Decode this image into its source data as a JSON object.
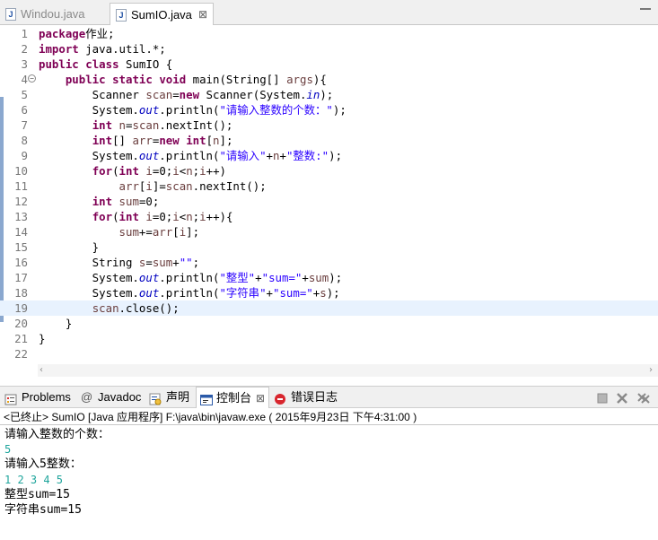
{
  "editor_tabs": [
    {
      "label": "Windou.java",
      "close": ""
    },
    {
      "label": "SumIO.java",
      "close": "⊠"
    }
  ],
  "code_lines": [
    {
      "n": "1",
      "parts": [
        [
          "kw",
          "package"
        ],
        [
          "",
          "作业;"
        ]
      ]
    },
    {
      "n": "2",
      "parts": [
        [
          "kw",
          "import"
        ],
        [
          "",
          " java.util.*;"
        ]
      ]
    },
    {
      "n": "3",
      "parts": [
        [
          "kw",
          "public"
        ],
        [
          "",
          " "
        ],
        [
          "kw",
          "class"
        ],
        [
          "",
          " SumIO {"
        ]
      ]
    },
    {
      "n": "4",
      "fold": "−",
      "parts": [
        [
          "",
          "    "
        ],
        [
          "kw",
          "public"
        ],
        [
          "",
          " "
        ],
        [
          "kw",
          "static"
        ],
        [
          "",
          " "
        ],
        [
          "kw",
          "void"
        ],
        [
          "",
          " main(String[] "
        ],
        [
          "var",
          "args"
        ],
        [
          "",
          "){"
        ]
      ]
    },
    {
      "n": "5",
      "parts": [
        [
          "",
          "        Scanner "
        ],
        [
          "var",
          "scan"
        ],
        [
          "",
          "="
        ],
        [
          "kw",
          "new"
        ],
        [
          "",
          " Scanner(System."
        ],
        [
          "fld",
          "in"
        ],
        [
          "",
          ");"
        ]
      ]
    },
    {
      "n": "6",
      "parts": [
        [
          "",
          "        System."
        ],
        [
          "fld",
          "out"
        ],
        [
          "",
          ".println("
        ],
        [
          "str",
          "\"请输入整数的个数：\""
        ],
        [
          "",
          ");"
        ]
      ]
    },
    {
      "n": "7",
      "parts": [
        [
          "",
          "        "
        ],
        [
          "kw",
          "int"
        ],
        [
          "",
          " "
        ],
        [
          "var",
          "n"
        ],
        [
          "",
          "="
        ],
        [
          "var",
          "scan"
        ],
        [
          "",
          ".nextInt();"
        ]
      ]
    },
    {
      "n": "8",
      "parts": [
        [
          "",
          "        "
        ],
        [
          "kw",
          "int"
        ],
        [
          "",
          "[] "
        ],
        [
          "var",
          "arr"
        ],
        [
          "",
          "="
        ],
        [
          "kw",
          "new"
        ],
        [
          "",
          " "
        ],
        [
          "kw",
          "int"
        ],
        [
          "",
          "["
        ],
        [
          "var",
          "n"
        ],
        [
          "",
          "];"
        ]
      ]
    },
    {
      "n": "9",
      "parts": [
        [
          "",
          "        System."
        ],
        [
          "fld",
          "out"
        ],
        [
          "",
          ".println("
        ],
        [
          "str",
          "\"请输入\""
        ],
        [
          "",
          "+"
        ],
        [
          "var",
          "n"
        ],
        [
          "",
          "+"
        ],
        [
          "str",
          "\"整数:\""
        ],
        [
          "",
          ");"
        ]
      ]
    },
    {
      "n": "10",
      "parts": [
        [
          "",
          "        "
        ],
        [
          "kw",
          "for"
        ],
        [
          "",
          "("
        ],
        [
          "kw",
          "int"
        ],
        [
          "",
          " "
        ],
        [
          "var",
          "i"
        ],
        [
          "",
          "=0;"
        ],
        [
          "var",
          "i"
        ],
        [
          "",
          "<"
        ],
        [
          "var",
          "n"
        ],
        [
          "",
          ";"
        ],
        [
          "var",
          "i"
        ],
        [
          "",
          "++)"
        ]
      ]
    },
    {
      "n": "11",
      "parts": [
        [
          "",
          "            "
        ],
        [
          "var",
          "arr"
        ],
        [
          "",
          "["
        ],
        [
          "var",
          "i"
        ],
        [
          "",
          "]="
        ],
        [
          "var",
          "scan"
        ],
        [
          "",
          ".nextInt();"
        ]
      ]
    },
    {
      "n": "12",
      "parts": [
        [
          "",
          "        "
        ],
        [
          "kw",
          "int"
        ],
        [
          "",
          " "
        ],
        [
          "var",
          "sum"
        ],
        [
          "",
          "=0;"
        ]
      ]
    },
    {
      "n": "13",
      "parts": [
        [
          "",
          "        "
        ],
        [
          "kw",
          "for"
        ],
        [
          "",
          "("
        ],
        [
          "kw",
          "int"
        ],
        [
          "",
          " "
        ],
        [
          "var",
          "i"
        ],
        [
          "",
          "=0;"
        ],
        [
          "var",
          "i"
        ],
        [
          "",
          "<"
        ],
        [
          "var",
          "n"
        ],
        [
          "",
          ";"
        ],
        [
          "var",
          "i"
        ],
        [
          "",
          "++){"
        ]
      ]
    },
    {
      "n": "14",
      "parts": [
        [
          "",
          "            "
        ],
        [
          "var",
          "sum"
        ],
        [
          "",
          "+="
        ],
        [
          "var",
          "arr"
        ],
        [
          "",
          "["
        ],
        [
          "var",
          "i"
        ],
        [
          "",
          "];"
        ]
      ]
    },
    {
      "n": "15",
      "parts": [
        [
          "",
          "        }"
        ]
      ]
    },
    {
      "n": "16",
      "parts": [
        [
          "",
          "        String "
        ],
        [
          "var",
          "s"
        ],
        [
          "",
          "="
        ],
        [
          "var",
          "sum"
        ],
        [
          "",
          "+"
        ],
        [
          "str",
          "\"\""
        ],
        [
          "",
          ";"
        ]
      ]
    },
    {
      "n": "17",
      "parts": [
        [
          "",
          "        System."
        ],
        [
          "fld",
          "out"
        ],
        [
          "",
          ".println("
        ],
        [
          "str",
          "\"整型\""
        ],
        [
          "",
          "+"
        ],
        [
          "str",
          "\"sum=\""
        ],
        [
          "",
          "+"
        ],
        [
          "var",
          "sum"
        ],
        [
          "",
          ");"
        ]
      ]
    },
    {
      "n": "18",
      "parts": [
        [
          "",
          "        System."
        ],
        [
          "fld",
          "out"
        ],
        [
          "",
          ".println("
        ],
        [
          "str",
          "\"字符串\""
        ],
        [
          "",
          "+"
        ],
        [
          "str",
          "\"sum=\""
        ],
        [
          "",
          "+"
        ],
        [
          "var",
          "s"
        ],
        [
          "",
          ");"
        ]
      ]
    },
    {
      "n": "19",
      "current": true,
      "parts": [
        [
          "",
          "        "
        ],
        [
          "var",
          "scan"
        ],
        [
          "",
          ".close();"
        ]
      ]
    },
    {
      "n": "20",
      "parts": [
        [
          "",
          "    }"
        ]
      ]
    },
    {
      "n": "21",
      "parts": [
        [
          "",
          "}"
        ]
      ]
    },
    {
      "n": "22",
      "parts": [
        [
          "",
          ""
        ]
      ]
    }
  ],
  "view_tabs": {
    "problems": "Problems",
    "javadoc": "Javadoc",
    "declaration": "声明",
    "console": "控制台",
    "console_close": "⊠",
    "error_log": "错误日志"
  },
  "console": {
    "header": "<已终止> SumIO [Java 应用程序] F:\\java\\bin\\javaw.exe ( 2015年9月23日 下午4:31:00 )",
    "lines": [
      {
        "type": "out",
        "text": "请输入整数的个数："
      },
      {
        "type": "in",
        "text": "5"
      },
      {
        "type": "out",
        "text": "请输入5整数："
      },
      {
        "type": "in",
        "text": "1 2 3 4 5"
      },
      {
        "type": "out",
        "text": "整型sum=15"
      },
      {
        "type": "out",
        "text": "字符串sum=15"
      }
    ]
  },
  "colors": {
    "keyword": "#7f0055",
    "string": "#2a00ff",
    "variable": "#6a3e3e",
    "field": "#0000c0",
    "stdin": "#1fa59c",
    "current_line": "#e8f2fe"
  }
}
